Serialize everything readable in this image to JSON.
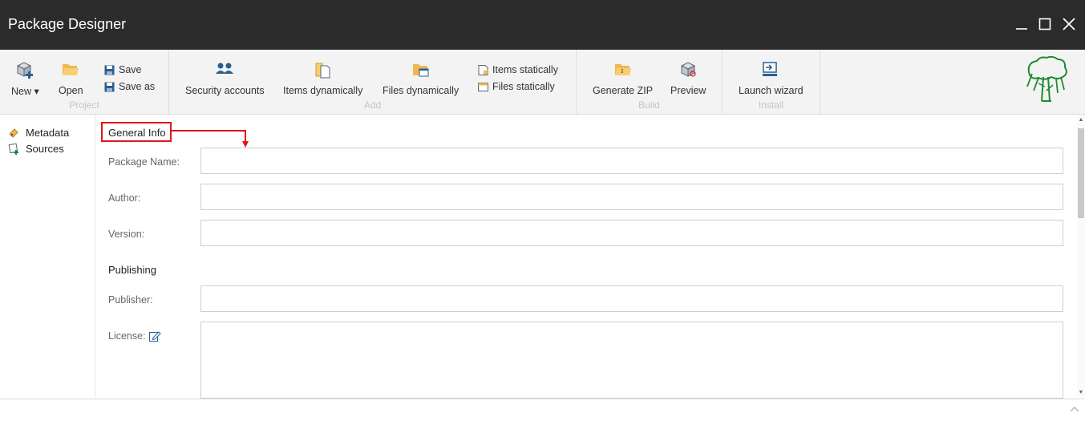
{
  "window": {
    "title": "Package Designer",
    "controls": {
      "minimize": "–",
      "maximize": "☐",
      "close": "✕"
    }
  },
  "ribbon": {
    "project": {
      "label": "Project",
      "new_label": "New ▾",
      "open_label": "Open",
      "save_label": "Save",
      "save_as_label": "Save as"
    },
    "add": {
      "label": "Add",
      "security_accounts_label": "Security accounts",
      "items_dynamically_label": "Items dynamically",
      "files_dynamically_label": "Files dynamically",
      "items_statically_label": "Items statically",
      "files_statically_label": "Files statically"
    },
    "build": {
      "label": "Build",
      "generate_zip_label": "Generate ZIP",
      "preview_label": "Preview"
    },
    "install": {
      "label": "Install",
      "launch_wizard_label": "Launch wizard"
    }
  },
  "sidebar": {
    "items": [
      {
        "label": "Metadata",
        "icon": "metadata-icon"
      },
      {
        "label": "Sources",
        "icon": "sources-icon"
      }
    ]
  },
  "form": {
    "general_info_heading": "General Info",
    "package_name_label": "Package Name:",
    "package_name_value": "",
    "author_label": "Author:",
    "author_value": "",
    "version_label": "Version:",
    "version_value": "",
    "publishing_heading": "Publishing",
    "publisher_label": "Publisher:",
    "publisher_value": "",
    "license_label": "License:",
    "license_value": ""
  },
  "colors": {
    "titlebar": "#2b2b2b",
    "ribbon": "#f3f3f3",
    "highlight": "#e0161c",
    "icon_blue": "#2a5f8f",
    "icon_folder": "#f0b850",
    "logo_green": "#1f8a2e"
  }
}
